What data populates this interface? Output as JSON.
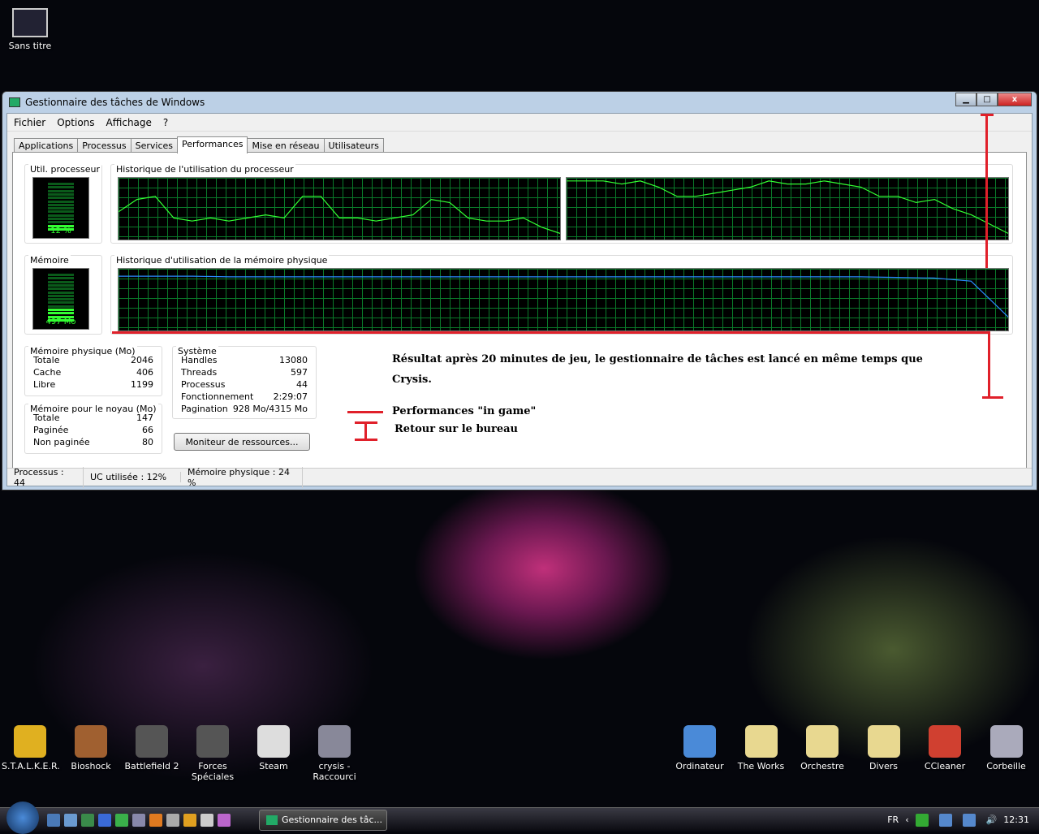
{
  "desktop": {
    "top_icon": "Sans titre",
    "icons_left": [
      "S.T.A.L.K.E.R.",
      "Bioshock",
      "Battlefield 2",
      "Forces Spéciales",
      "Steam",
      "crysis - Raccourci"
    ],
    "icons_right": [
      "Ordinateur",
      "The Works",
      "Orchestre",
      "Divers",
      "CCleaner",
      "Corbeille"
    ]
  },
  "window": {
    "title": "Gestionnaire des tâches de Windows",
    "menu": [
      "Fichier",
      "Options",
      "Affichage",
      "?"
    ],
    "tabs": [
      "Applications",
      "Processus",
      "Services",
      "Performances",
      "Mise en réseau",
      "Utilisateurs"
    ],
    "active_tab": "Performances",
    "cpu_label": "Util. processeur",
    "cpu_value": "12 %",
    "cpu_history_label": "Historique de l'utilisation du processeur",
    "mem_label": "Mémoire",
    "mem_value": "497 Mo",
    "mem_history_label": "Historique d'utilisation de la mémoire physique",
    "cpu_history_core1": [
      45,
      65,
      70,
      35,
      30,
      35,
      30,
      35,
      40,
      35,
      70,
      70,
      35,
      35,
      30,
      35,
      40,
      65,
      60,
      35,
      30,
      30,
      35,
      20,
      10
    ],
    "cpu_history_core2": [
      95,
      95,
      95,
      90,
      95,
      85,
      70,
      70,
      75,
      80,
      85,
      95,
      90,
      90,
      95,
      90,
      85,
      70,
      70,
      60,
      65,
      50,
      40,
      25,
      10
    ],
    "mem_history": [
      88,
      88,
      88,
      87,
      87,
      87,
      87,
      87,
      87,
      87,
      87,
      87,
      87,
      87,
      87,
      87,
      87,
      87,
      87,
      87,
      87,
      86,
      85,
      80,
      22
    ],
    "phys_mem": {
      "title": "Mémoire physique (Mo)",
      "rows": [
        [
          "Totale",
          "2046"
        ],
        [
          "Cache",
          "406"
        ],
        [
          "Libre",
          "1199"
        ]
      ]
    },
    "kernel_mem": {
      "title": "Mémoire pour le noyau (Mo)",
      "rows": [
        [
          "Totale",
          "147"
        ],
        [
          "Paginée",
          "66"
        ],
        [
          "Non paginée",
          "80"
        ]
      ]
    },
    "system": {
      "title": "Système",
      "rows": [
        [
          "Handles",
          "13080"
        ],
        [
          "Threads",
          "597"
        ],
        [
          "Processus",
          "44"
        ],
        [
          "Fonctionnement",
          "2:29:07"
        ],
        [
          "Pagination",
          "928 Mo/4315 Mo"
        ]
      ]
    },
    "resource_button": "Moniteur de ressources...",
    "status": [
      "Processus : 44",
      "UC utilisée : 12%",
      "Mémoire physique : 24 %"
    ]
  },
  "annotation": {
    "line1": "Résultat après 20 minutes de jeu, le gestionnaire de tâches est lancé en même temps que Crysis.",
    "legend_line": "Performances \"in game\"",
    "legend_bracket": "Retour sur le bureau"
  },
  "taskbar": {
    "task": "Gestionnaire des tâc...",
    "lang": "FR",
    "clock": "12:31"
  },
  "colors": {
    "graph_line": "#33ff33",
    "mem_line": "#2a8cff",
    "annotation_red": "#e0202a"
  }
}
